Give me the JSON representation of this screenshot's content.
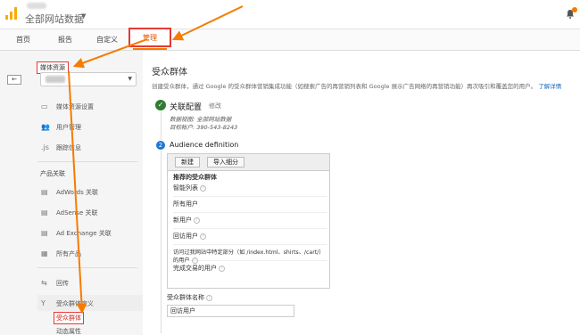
{
  "header": {
    "account_title": "全部网站数据",
    "caret": "▼"
  },
  "nav": {
    "home": "首页",
    "reports": "报告",
    "custom": "自定义",
    "admin": "管理"
  },
  "sidebar": {
    "property_label": "媒体资源",
    "back": "←",
    "items": [
      {
        "label": "媒体资源设置"
      },
      {
        "label": "用户管理"
      },
      {
        "label": "跟踪信息"
      }
    ],
    "product_links_heading": "产品关联",
    "product_links": [
      {
        "label": "AdWords 关联"
      },
      {
        "label": "AdSense 关联"
      },
      {
        "label": "Ad Exchange 关联"
      },
      {
        "label": "所有产品"
      }
    ],
    "postbacks": "回传",
    "audience_definitions": "受众群体定义",
    "audiences": "受众群体",
    "dynamic_attributes": "动态属性"
  },
  "main": {
    "title": "受众群体",
    "description": "创建受众群体，通过 Google 的受众群体营销集成功能（如搜索广告的再营销列表和 Google 展示广告网络的再营销功能）再次吸引和覆盖您的用户。",
    "learn_more": "了解详情",
    "step1": {
      "title": "关联配置",
      "edit": "修改",
      "source_line": "数据视图: 全部网站数据",
      "target_line": "目标帐户: 390-543-8243"
    },
    "step2": {
      "number": "2",
      "title": "Audience definition",
      "btn_new": "新建",
      "btn_import": "导入细分",
      "recommended_heading": "推荐的受众群体",
      "recommended": [
        "智能列表",
        "所有用户",
        "新用户",
        "回访用户",
        "访问过我网站中特定部分（如 /index.html、shirts、/cart/）的用户",
        "完成交易的用户"
      ]
    },
    "name_label": "受众群体名称",
    "name_value": "回访用户"
  },
  "colors": {
    "highlight_border": "#e53935",
    "arrow": "#f57c00",
    "accent": "#f57c00",
    "success": "#2e7d32",
    "step": "#1976d2"
  }
}
